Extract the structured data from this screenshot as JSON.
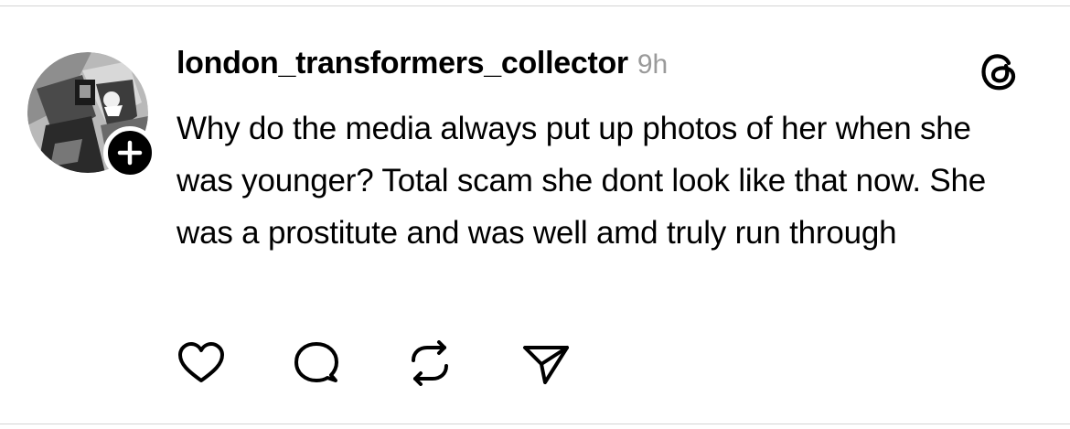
{
  "post": {
    "author": {
      "username": "london_transformers_collector",
      "avatar_icon": "avatar-robot-photo",
      "follow_icon": "plus-icon"
    },
    "timestamp": "9h",
    "text": "Why do the media always put up photos of her when she was younger? Total scam she dont look like that now. She was a prostitute and was well amd truly run through",
    "app_icon": "threads-logo-icon"
  },
  "actions": [
    {
      "name": "like",
      "icon": "heart-icon"
    },
    {
      "name": "reply",
      "icon": "comment-icon"
    },
    {
      "name": "repost",
      "icon": "repost-icon"
    },
    {
      "name": "share",
      "icon": "share-icon"
    }
  ],
  "colors": {
    "text": "#000000",
    "secondary_text": "#9a9a9a",
    "divider": "#d4d4d4",
    "background": "#ffffff"
  }
}
